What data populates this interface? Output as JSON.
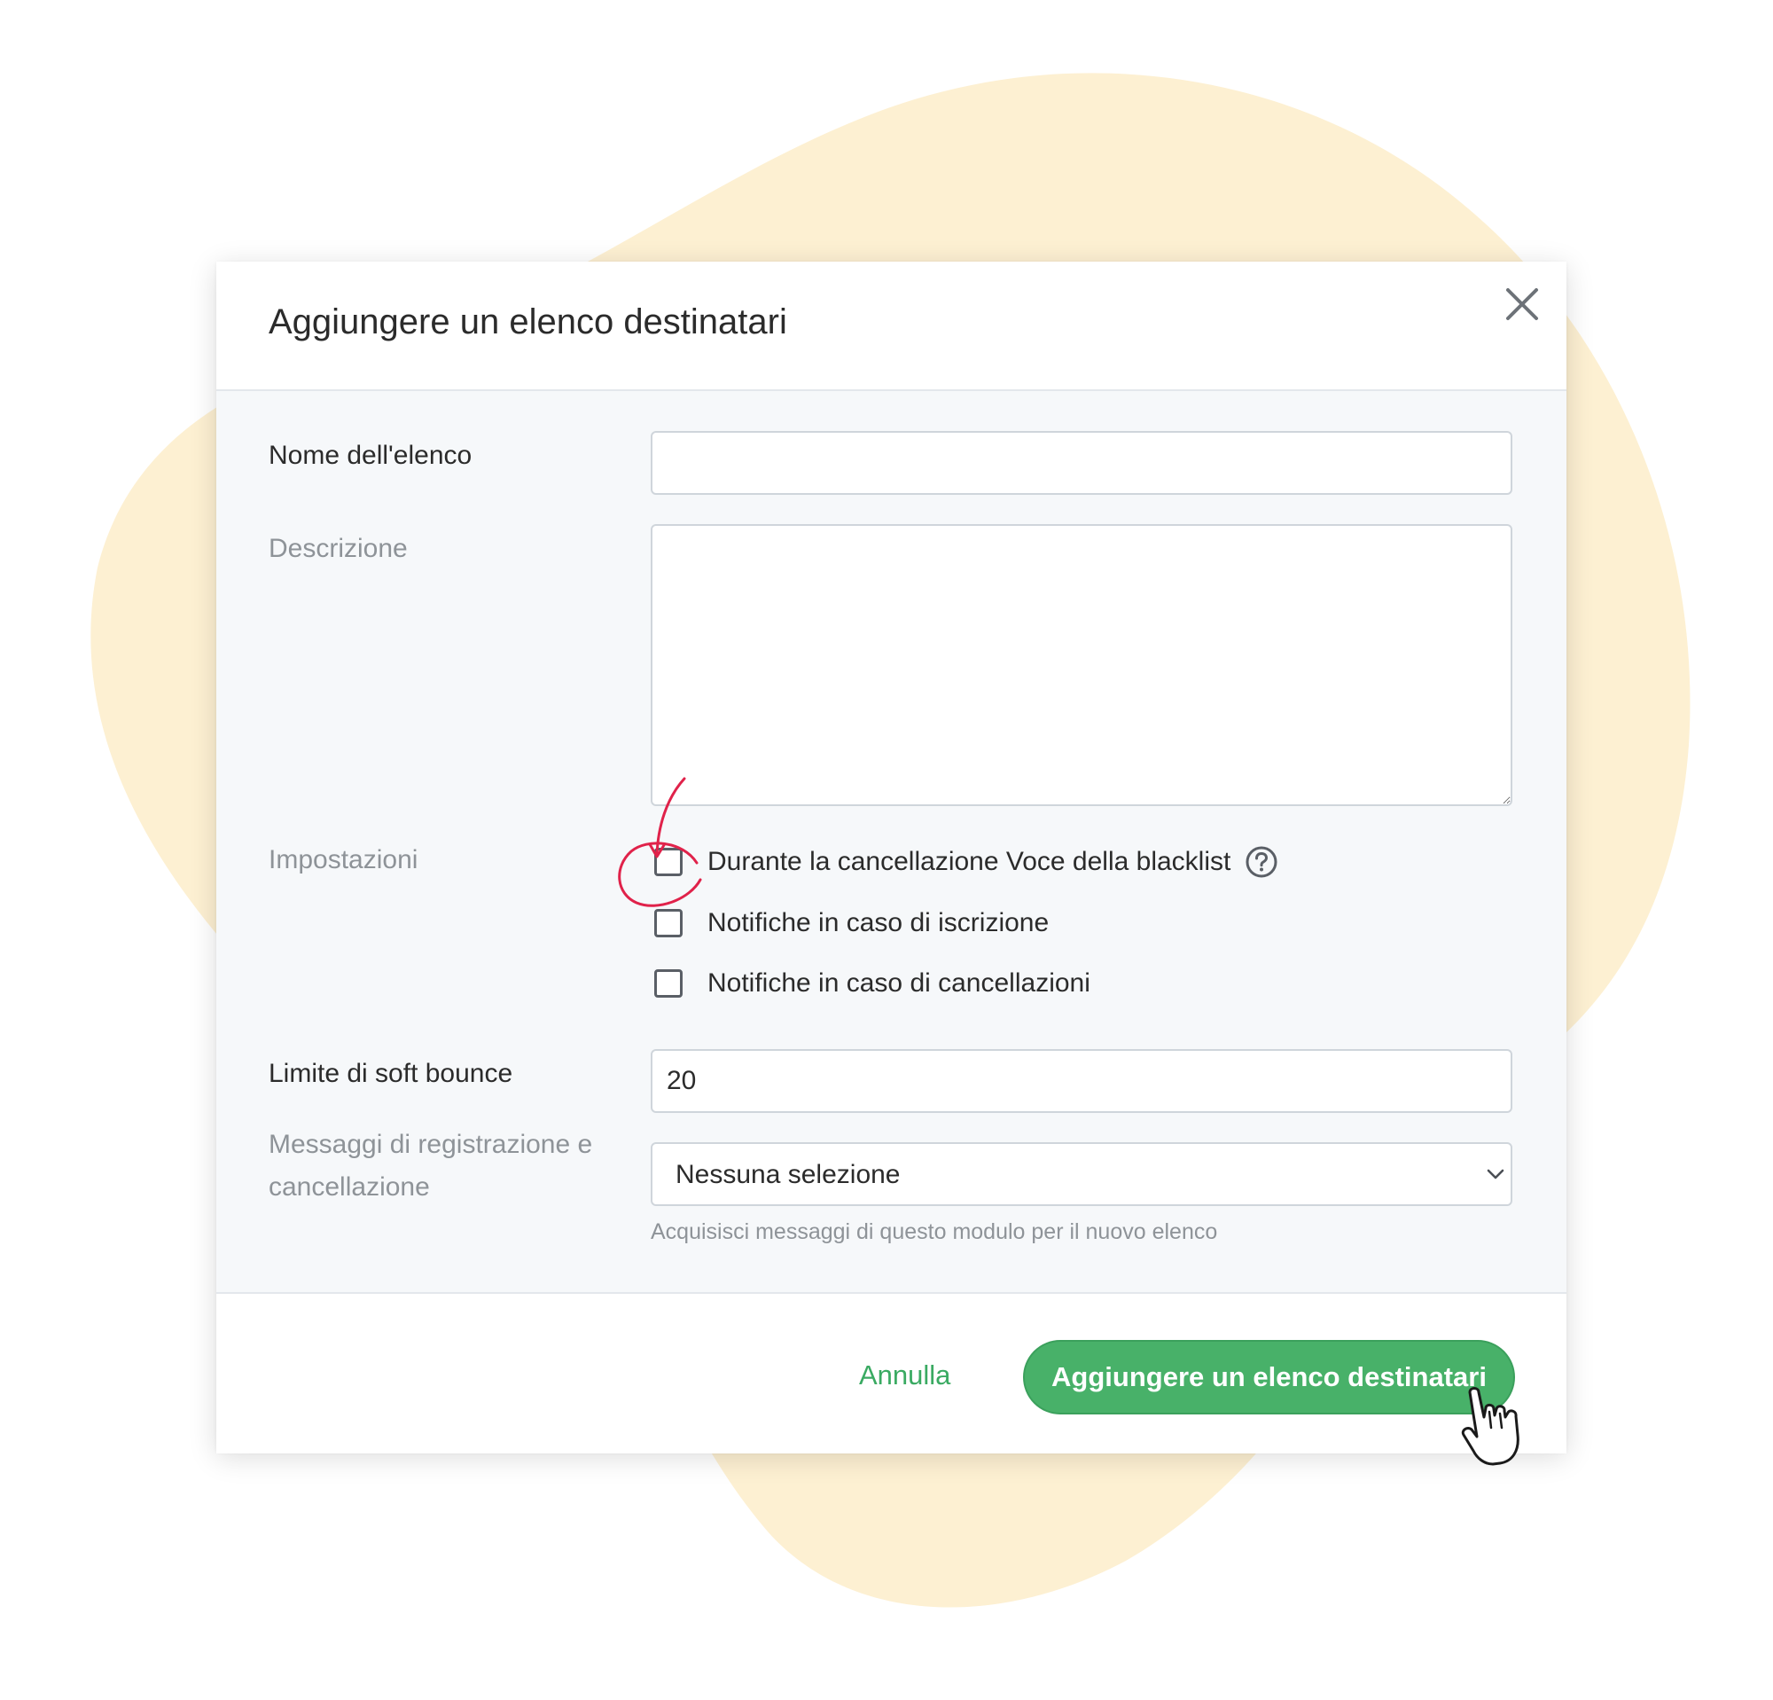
{
  "modal": {
    "title": "Aggiungere un elenco destinatari",
    "close_icon": "close-icon"
  },
  "form": {
    "list_name": {
      "label": "Nome dell'elenco",
      "value": ""
    },
    "description": {
      "label": "Descrizione",
      "value": ""
    },
    "settings": {
      "label": "Impostazioni",
      "options": [
        {
          "label": "Durante la cancellazione Voce della blacklist",
          "checked": false,
          "has_help_icon": true
        },
        {
          "label": "Notifiche in caso di iscrizione",
          "checked": false
        },
        {
          "label": "Notifiche in caso di cancellazioni",
          "checked": false
        }
      ],
      "help_icon": "question-circle-icon"
    },
    "soft_bounce": {
      "label": "Limite di soft bounce",
      "value": "20"
    },
    "messages": {
      "label": "Messaggi di registrazione e cancellazione",
      "selected": "Nessuna selezione",
      "hint": "Acquisisci messaggi di questo modulo per il nuovo elenco",
      "arrow_icon": "chevron-down-icon"
    }
  },
  "footer": {
    "cancel_label": "Annulla",
    "submit_label": "Aggiungere un elenco destinatari"
  },
  "colors": {
    "accent_green": "#48b169",
    "link_green": "#3aaa62",
    "blob_yellow": "#fdf0d2",
    "annotation_red": "#e0224a"
  },
  "decorations": {
    "annotation": "red-circle-and-arrow",
    "cursor_icon": "hand-pointer-icon"
  }
}
